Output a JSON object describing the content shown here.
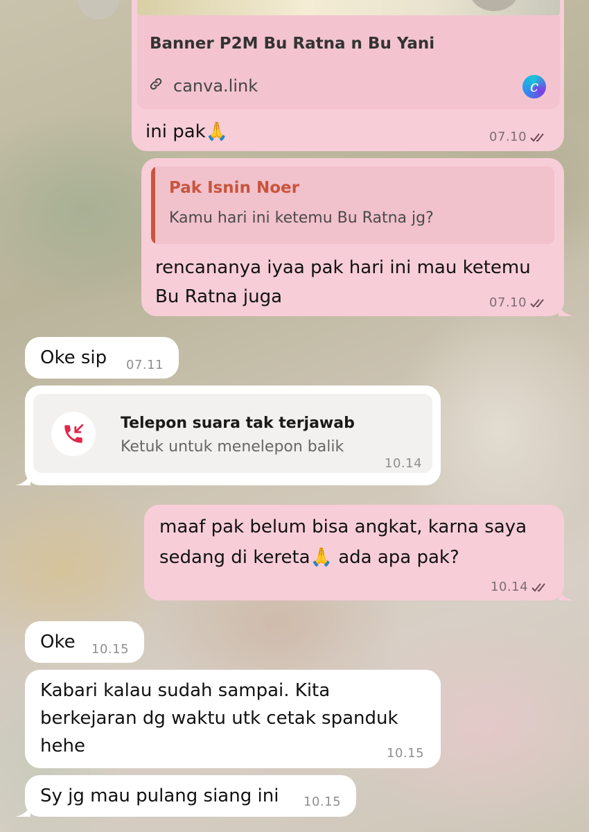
{
  "messages": {
    "m1": {
      "preview_title": "Banner P2M Bu Ratna n Bu Yani",
      "preview_domain": "canva.link",
      "text": "ini pak🙏",
      "time": "07.10"
    },
    "m2": {
      "quote_name": "Pak Isnin Noer",
      "quote_text": "Kamu hari ini ketemu Bu Ratna jg?",
      "text_line1": "rencananya iyaa pak hari ini mau ketemu",
      "text_line2": "Bu Ratna juga",
      "time": "07.10"
    },
    "m3": {
      "text": "Oke sip",
      "time": "07.11"
    },
    "m4": {
      "call_title": "Telepon suara tak terjawab",
      "call_sub": "Ketuk untuk menelepon balik",
      "time": "10.14"
    },
    "m5": {
      "text_line1": "maaf pak belum bisa angkat, karna saya",
      "text_line2": "sedang di kereta🙏 ada apa pak?",
      "time": "10.14"
    },
    "m6": {
      "text": "Oke",
      "time": "10.15"
    },
    "m7": {
      "text_line1": "Kabari kalau sudah sampai. Kita",
      "text_line2": "berkejaran dg waktu utk cetak spanduk",
      "text_line3": "hehe",
      "time": "10.15"
    },
    "m8": {
      "text": "Sy jg mau pulang siang ini",
      "time": "10.15"
    }
  },
  "colors": {
    "outgoing_bubble": "#f7cdd8",
    "incoming_bubble": "#ffffff",
    "quote_accent": "#c8553d",
    "missed_call_red": "#e0284a",
    "read_tick": "#6b4a55"
  },
  "icons": {
    "read_receipt": "double-check-icon",
    "link": "link-icon",
    "canva": "canva-logo-icon",
    "missed_call": "missed-call-icon"
  }
}
